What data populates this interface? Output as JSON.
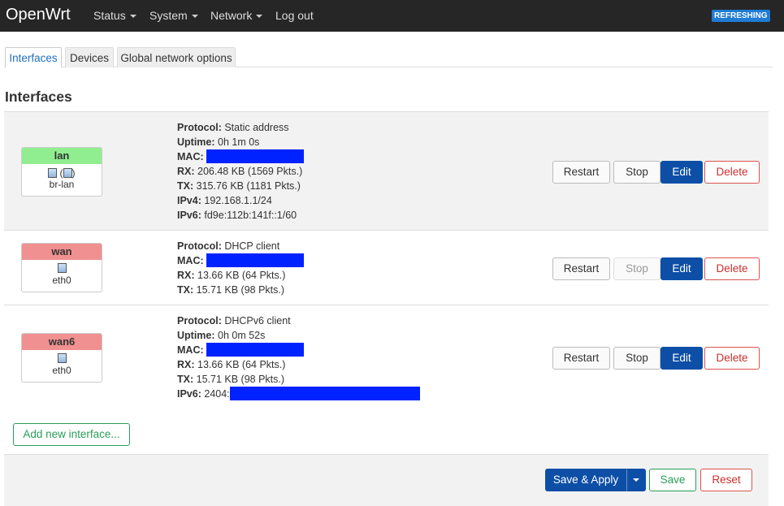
{
  "navbar": {
    "brand": "OpenWrt",
    "menu": [
      "Status",
      "System",
      "Network",
      "Log out"
    ],
    "badge": "REFRESHING"
  },
  "tabs": [
    "Interfaces",
    "Devices",
    "Global network options"
  ],
  "section_title": "Interfaces",
  "interfaces": [
    {
      "name": "lan",
      "device": "br-lan",
      "status_color": "#90ee90",
      "details": [
        {
          "label": "Protocol:",
          "value": "Static address"
        },
        {
          "label": "Uptime:",
          "value": "0h 1m 0s"
        },
        {
          "label": "MAC:",
          "value": ""
        },
        {
          "label": "RX:",
          "value": "206.48 KB (1569 Pkts.)"
        },
        {
          "label": "TX:",
          "value": "315.76 KB (1181 Pkts.)"
        },
        {
          "label": "IPv4:",
          "value": "192.168.1.1/24"
        },
        {
          "label": "IPv6:",
          "value": "fd9e:112b:141f::1/60"
        }
      ],
      "stop_enabled": true
    },
    {
      "name": "wan",
      "device": "eth0",
      "status_color": "#f09090",
      "details": [
        {
          "label": "Protocol:",
          "value": "DHCP client"
        },
        {
          "label": "MAC:",
          "value": ""
        },
        {
          "label": "RX:",
          "value": "13.66 KB (64 Pkts.)"
        },
        {
          "label": "TX:",
          "value": "15.71 KB (98 Pkts.)"
        }
      ],
      "stop_enabled": false
    },
    {
      "name": "wan6",
      "device": "eth0",
      "status_color": "#f09090",
      "details": [
        {
          "label": "Protocol:",
          "value": "DHCPv6 client"
        },
        {
          "label": "Uptime:",
          "value": "0h 0m 52s"
        },
        {
          "label": "MAC:",
          "value": ""
        },
        {
          "label": "RX:",
          "value": "13.66 KB (64 Pkts.)"
        },
        {
          "label": "TX:",
          "value": "15.71 KB (98 Pkts.)"
        },
        {
          "label": "IPv6:",
          "value": "2404:"
        }
      ],
      "stop_enabled": true
    }
  ],
  "row_buttons": {
    "restart": "Restart",
    "stop": "Stop",
    "edit": "Edit",
    "delete": "Delete"
  },
  "add_interface": "Add new interface...",
  "footer": {
    "save_apply": "Save & Apply",
    "save": "Save",
    "reset": "Reset"
  },
  "colors": {
    "primary": "#0d4fa6",
    "danger": "#d9534f",
    "success": "#2a9d5a",
    "redacted": "#0022ff"
  }
}
